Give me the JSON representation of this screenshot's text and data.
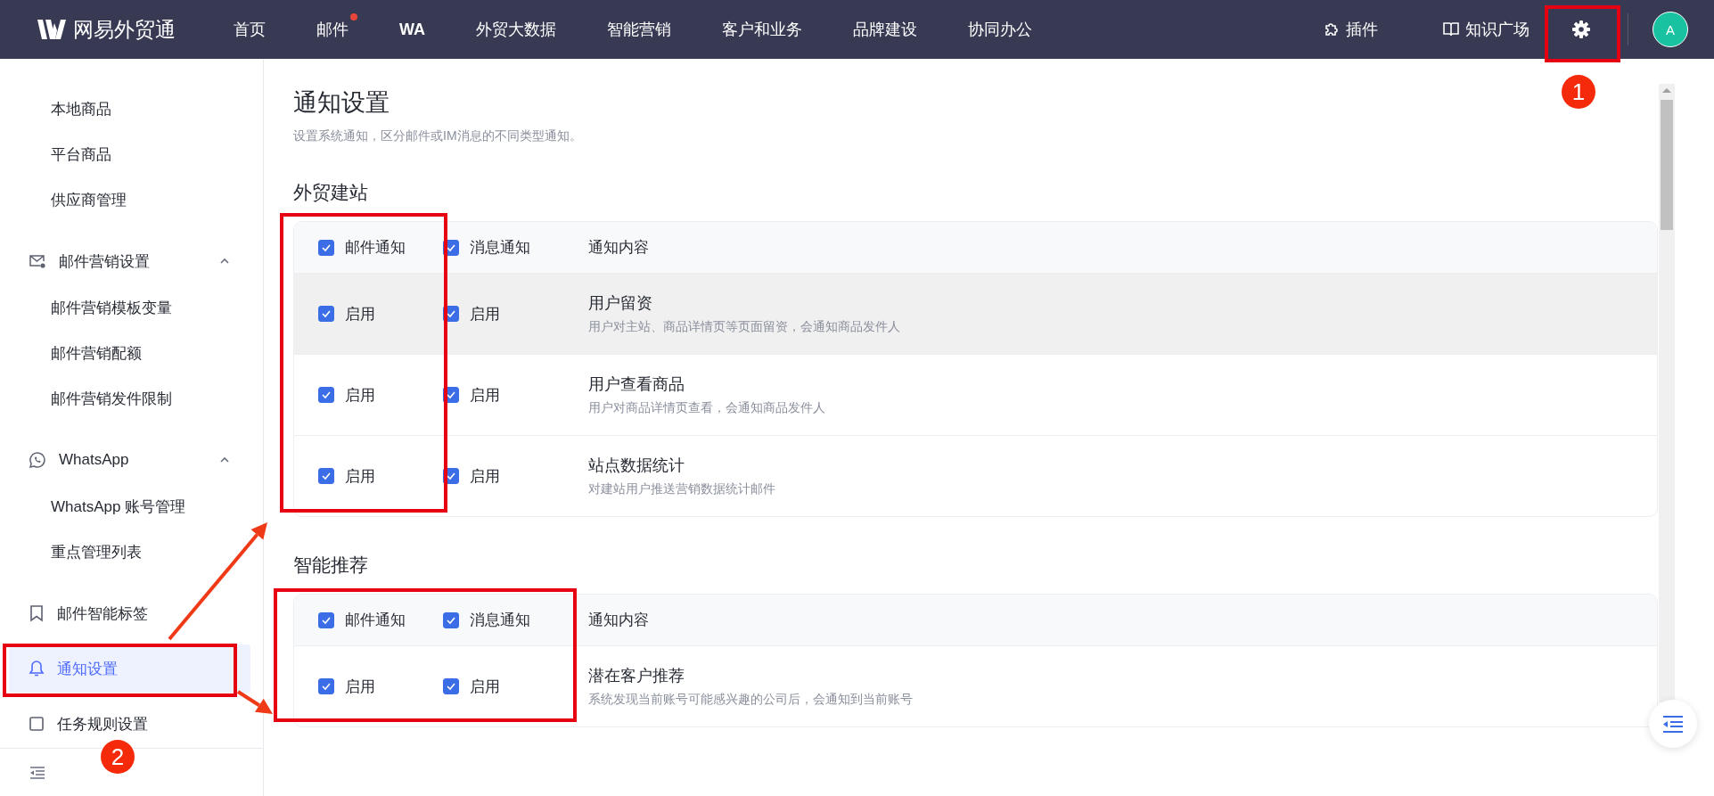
{
  "top_nav": {
    "logo": "网易外贸通",
    "items": [
      {
        "label": "首页",
        "dot": false,
        "bold": false
      },
      {
        "label": "邮件",
        "dot": true,
        "bold": false
      },
      {
        "label": "WA",
        "dot": false,
        "bold": true
      },
      {
        "label": "外贸大数据",
        "dot": false,
        "bold": false
      },
      {
        "label": "智能营销",
        "dot": false,
        "bold": false
      },
      {
        "label": "客户和业务",
        "dot": false,
        "bold": false
      },
      {
        "label": "品牌建设",
        "dot": false,
        "bold": false
      },
      {
        "label": "协同办公",
        "dot": false,
        "bold": false
      }
    ],
    "plugin": "插件",
    "knowledge": "知识广场",
    "avatar": "A"
  },
  "sidebar": {
    "items": [
      {
        "kind": "sub",
        "label": "本地商品",
        "selected": false
      },
      {
        "kind": "sub",
        "label": "平台商品",
        "selected": false
      },
      {
        "kind": "sub",
        "label": "供应商管理",
        "selected": false
      },
      {
        "kind": "group",
        "label": "邮件营销设置",
        "expanded": true,
        "selected": false
      },
      {
        "kind": "sub",
        "label": "邮件营销模板变量",
        "selected": false
      },
      {
        "kind": "sub",
        "label": "邮件营销配额",
        "selected": false
      },
      {
        "kind": "sub",
        "label": "邮件营销发件限制",
        "selected": false
      },
      {
        "kind": "group",
        "label": "WhatsApp",
        "expanded": true,
        "selected": false
      },
      {
        "kind": "sub",
        "label": "WhatsApp 账号管理",
        "selected": false
      },
      {
        "kind": "sub",
        "label": "重点管理列表",
        "selected": false
      },
      {
        "kind": "page",
        "label": "邮件智能标签",
        "selected": false
      },
      {
        "kind": "page",
        "label": "通知设置",
        "selected": true
      },
      {
        "kind": "page",
        "label": "任务规则设置",
        "selected": false
      }
    ]
  },
  "page": {
    "title": "通知设置",
    "subtitle": "设置系统通知，区分邮件或IM消息的不同类型通知。"
  },
  "sections": [
    {
      "title": "外贸建站",
      "header": {
        "email": {
          "label": "邮件通知",
          "checked": true
        },
        "message": {
          "label": "消息通知",
          "checked": true
        },
        "content": "通知内容"
      },
      "rows": [
        {
          "email": {
            "label": "启用",
            "checked": true
          },
          "message": {
            "label": "启用",
            "checked": true
          },
          "title": "用户留资",
          "description": "用户对主站、商品详情页等页面留资，会通知商品发件人",
          "highlighted": true
        },
        {
          "email": {
            "label": "启用",
            "checked": true
          },
          "message": {
            "label": "启用",
            "checked": true
          },
          "title": "用户查看商品",
          "description": "用户对商品详情页查看，会通知商品发件人",
          "highlighted": false
        },
        {
          "email": {
            "label": "启用",
            "checked": true
          },
          "message": {
            "label": "启用",
            "checked": true
          },
          "title": "站点数据统计",
          "description": "对建站用户推送营销数据统计邮件",
          "highlighted": false
        }
      ]
    },
    {
      "title": "智能推荐",
      "header": {
        "email": {
          "label": "邮件通知",
          "checked": true
        },
        "message": {
          "label": "消息通知",
          "checked": true
        },
        "content": "通知内容"
      },
      "rows": [
        {
          "email": {
            "label": "启用",
            "checked": true
          },
          "message": {
            "label": "启用",
            "checked": true
          },
          "title": "潜在客户推荐",
          "description": "系统发现当前账号可能感兴趣的公司后，会通知到当前账号",
          "highlighted": false
        }
      ]
    }
  ],
  "annotations": {
    "badges": [
      "1",
      "2"
    ]
  }
}
